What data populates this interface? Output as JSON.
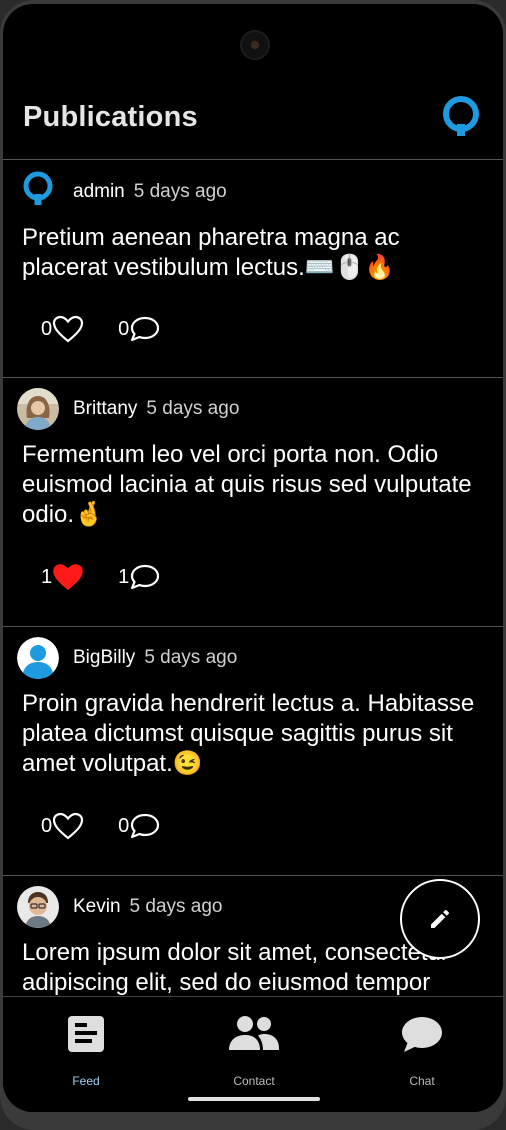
{
  "header": {
    "title": "Publications"
  },
  "posts": [
    {
      "author": "admin",
      "time": "5 days ago",
      "text": "Pretium aenean pharetra magna ac placerat vestibulum lectus.⌨️🖱️🔥",
      "likes": "0",
      "comments": "0",
      "liked": false,
      "avatar": "admin-logo-avatar"
    },
    {
      "author": "Brittany",
      "time": "5 days ago",
      "text": "Fermentum leo vel orci porta non. Odio euismod lacinia at quis risus sed vulputate odio.🤞",
      "likes": "1",
      "comments": "1",
      "liked": true,
      "avatar": "brittany-photo-avatar"
    },
    {
      "author": "BigBilly",
      "time": "5 days ago",
      "text": "Proin gravida hendrerit lectus a. Habitasse platea dictumst quisque sagittis purus sit amet volutpat.😉",
      "likes": "0",
      "comments": "0",
      "liked": false,
      "avatar": "default-user-avatar"
    },
    {
      "author": "Kevin",
      "time": "5 days ago",
      "text": "Lorem ipsum dolor sit amet, consectetur adipiscing elit, sed do eiusmod tempor",
      "likes": "",
      "comments": "",
      "liked": false,
      "avatar": "kevin-photo-avatar"
    }
  ],
  "fab": {
    "icon": "pencil-icon"
  },
  "nav": [
    {
      "label": "Feed",
      "icon": "feed-icon",
      "active": true
    },
    {
      "label": "Contact",
      "icon": "contacts-icon",
      "active": false
    },
    {
      "label": "Chat",
      "icon": "chat-bubble-icon",
      "active": false
    }
  ],
  "colors": {
    "background": "#000000",
    "accent_blue": "#1e9be0",
    "liked_red": "#ff1a1a",
    "active_nav": "#9fd3f5",
    "divider": "#555555"
  }
}
